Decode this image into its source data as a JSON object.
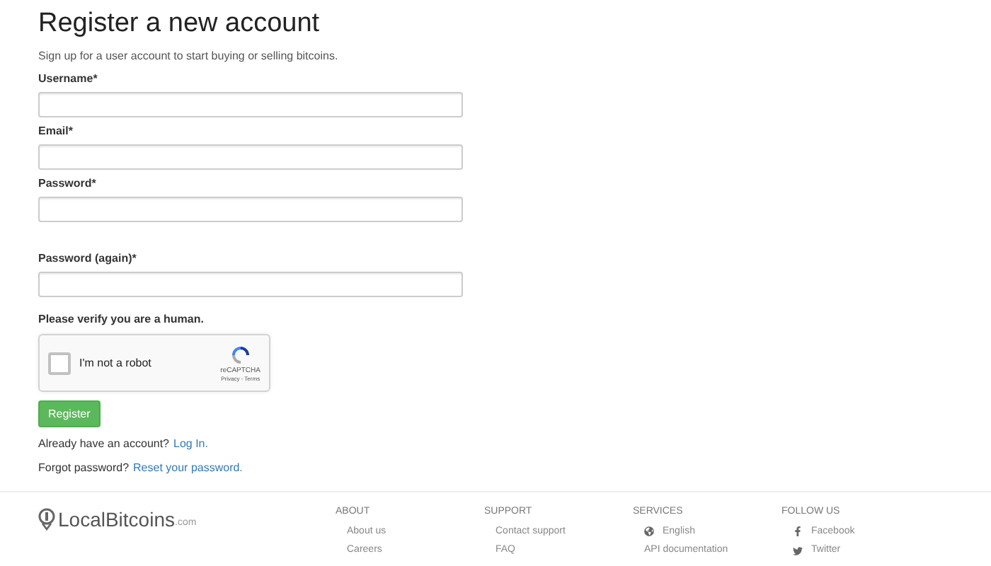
{
  "title": "Register a new account",
  "subtitle": "Sign up for a user account to start buying or selling bitcoins.",
  "fields": [
    {
      "label": "Username*"
    },
    {
      "label": "Email*"
    },
    {
      "label": "Password*"
    },
    {
      "label": "Password (again)*"
    }
  ],
  "captcha": {
    "prompt": "Please verify you are a human.",
    "label": "I'm not a robot",
    "checked": false,
    "brand": "reCAPTCHA",
    "links": "Privacy - Terms"
  },
  "register_button": "Register",
  "login_line": {
    "text": "Already have an account?",
    "link": "Log In."
  },
  "reset_line": {
    "text": "Forgot password?",
    "link": "Reset your password."
  },
  "footer": {
    "logo": {
      "name": "LocalBitcoins",
      "suffix": ".com"
    },
    "columns": [
      {
        "heading": "ABOUT",
        "links": [
          {
            "label": "About us"
          },
          {
            "label": "Careers"
          }
        ]
      },
      {
        "heading": "SUPPORT",
        "links": [
          {
            "label": "Contact support"
          },
          {
            "label": "FAQ"
          }
        ]
      },
      {
        "heading": "SERVICES",
        "links": [
          {
            "label": "English",
            "kind": "globe"
          },
          {
            "label": "API documentation"
          }
        ]
      },
      {
        "heading": "FOLLOW US",
        "links": [
          {
            "label": "Facebook",
            "kind": "facebook"
          },
          {
            "label": "Twitter",
            "kind": "twitter"
          }
        ]
      }
    ]
  }
}
